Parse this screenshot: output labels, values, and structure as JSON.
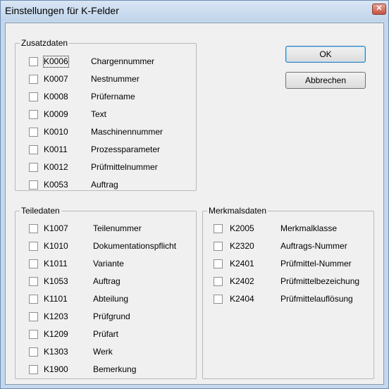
{
  "window": {
    "title": "Einstellungen für K-Felder",
    "close_glyph": "✕"
  },
  "buttons": {
    "ok": "OK",
    "cancel": "Abbrechen"
  },
  "zusatzdaten": {
    "label": "Zusatzdaten",
    "items": [
      {
        "code": "K0006",
        "desc": "Chargennummer"
      },
      {
        "code": "K0007",
        "desc": "Nestnummer"
      },
      {
        "code": "K0008",
        "desc": "Prüfername"
      },
      {
        "code": "K0009",
        "desc": "Text"
      },
      {
        "code": "K0010",
        "desc": "Maschinennummer"
      },
      {
        "code": "K0011",
        "desc": "Prozessparameter"
      },
      {
        "code": "K0012",
        "desc": "Prüfmittelnummer"
      },
      {
        "code": "K0053",
        "desc": "Auftrag"
      }
    ]
  },
  "teiledaten": {
    "label": "Teiledaten",
    "items": [
      {
        "code": "K1007",
        "desc": "Teilenummer"
      },
      {
        "code": "K1010",
        "desc": "Dokumentationspflicht"
      },
      {
        "code": "K1011",
        "desc": "Variante"
      },
      {
        "code": "K1053",
        "desc": "Auftrag"
      },
      {
        "code": "K1101",
        "desc": "Abteilung"
      },
      {
        "code": "K1203",
        "desc": "Prüfgrund"
      },
      {
        "code": "K1209",
        "desc": "Prüfart"
      },
      {
        "code": "K1303",
        "desc": "Werk"
      },
      {
        "code": "K1900",
        "desc": "Bemerkung"
      }
    ]
  },
  "merkmalsdaten": {
    "label": "Merkmalsdaten",
    "items": [
      {
        "code": "K2005",
        "desc": "Merkmalklasse"
      },
      {
        "code": "K2320",
        "desc": "Auftrags-Nummer"
      },
      {
        "code": "K2401",
        "desc": "Prüfmittel-Nummer"
      },
      {
        "code": "K2402",
        "desc": "Prüfmittelbezeichung"
      },
      {
        "code": "K2404",
        "desc": "Prüfmittelauflösung"
      }
    ]
  }
}
